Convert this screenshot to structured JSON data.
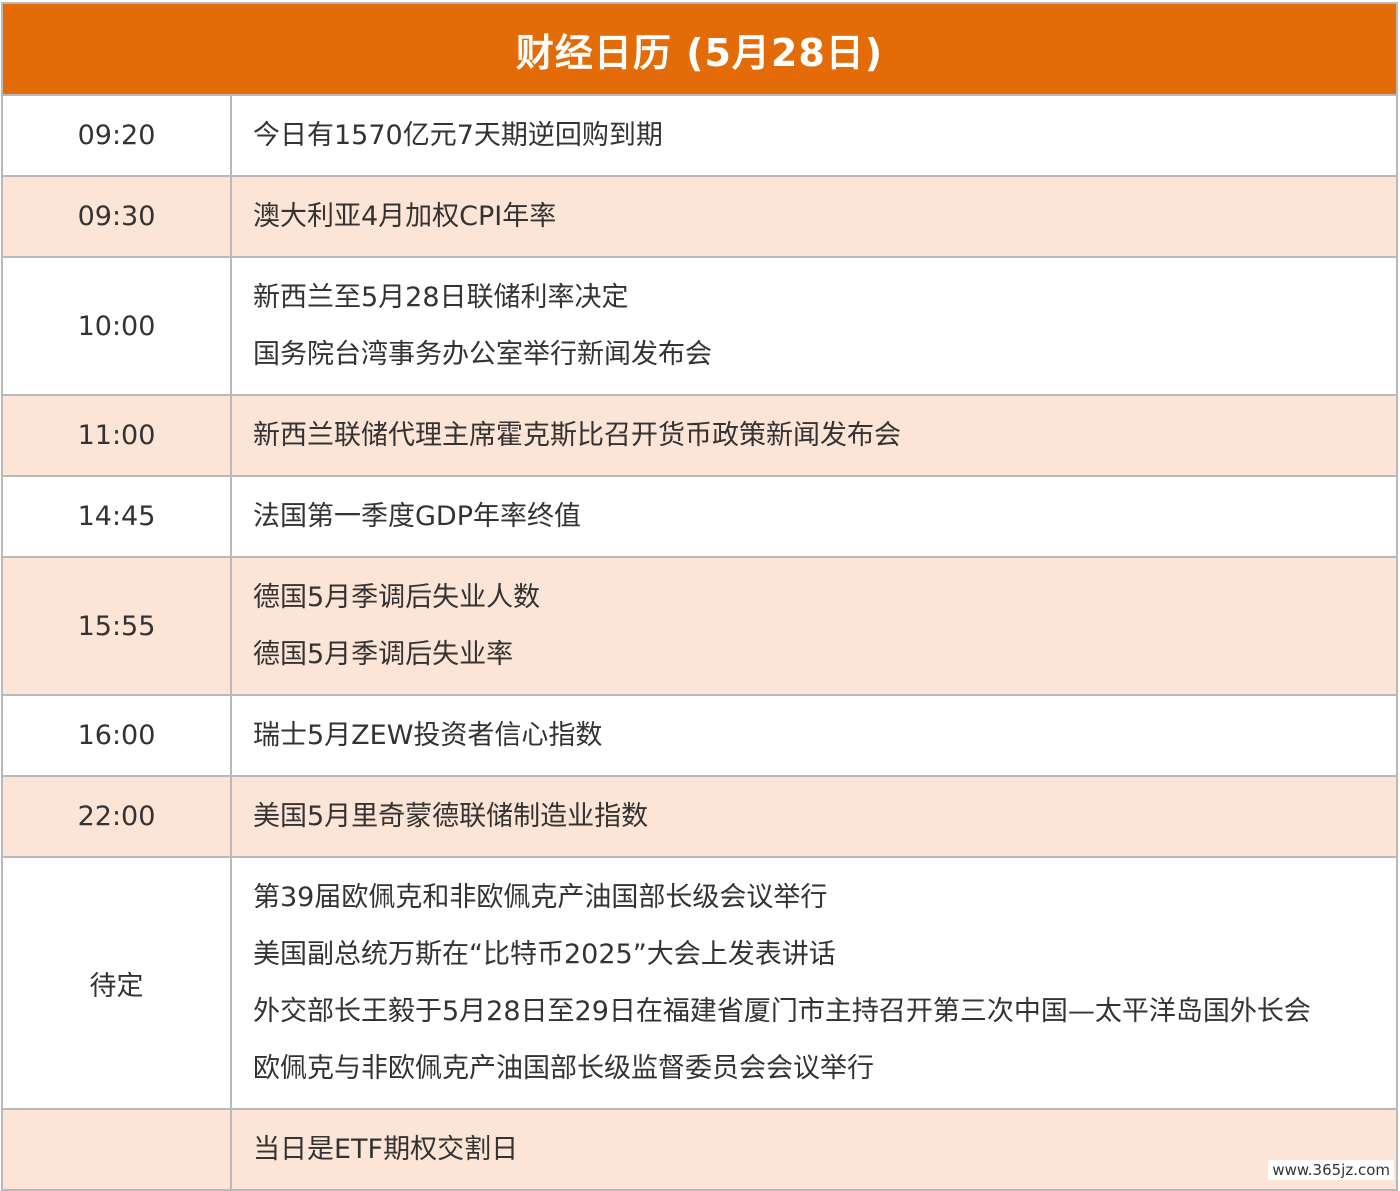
{
  "title": "财经日历 (5月28日)",
  "rows": [
    {
      "time": "09:20",
      "events": [
        "今日有1570亿元7天期逆回购到期"
      ]
    },
    {
      "time": "09:30",
      "events": [
        "澳大利亚4月加权CPI年率"
      ]
    },
    {
      "time": "10:00",
      "events": [
        "新西兰至5月28日联储利率决定",
        "国务院台湾事务办公室举行新闻发布会"
      ]
    },
    {
      "time": "11:00",
      "events": [
        "新西兰联储代理主席霍克斯比召开货币政策新闻发布会"
      ]
    },
    {
      "time": "14:45",
      "events": [
        "法国第一季度GDP年率终值"
      ]
    },
    {
      "time": "15:55",
      "events": [
        "德国5月季调后失业人数",
        "德国5月季调后失业率"
      ]
    },
    {
      "time": "16:00",
      "events": [
        "瑞士5月ZEW投资者信心指数"
      ]
    },
    {
      "time": "22:00",
      "events": [
        "美国5月里奇蒙德联储制造业指数"
      ]
    },
    {
      "time": "待定",
      "events": [
        "第39届欧佩克和非欧佩克产油国部长级会议举行",
        "美国副总统万斯在“比特币2025”大会上发表讲话",
        "外交部长王毅于5月28日至29日在福建省厦门市主持召开第三次中国—太平洋岛国外长会",
        "欧佩克与非欧佩克产油国部长级监督委员会会议举行"
      ]
    },
    {
      "time": "",
      "events": [
        "当日是ETF期权交割日"
      ]
    }
  ],
  "watermark": "www.365jz.com",
  "colors": {
    "header_bg": "#e36c09",
    "header_text": "#ffffff",
    "row_alt_bg": "#fce4d6",
    "row_bg": "#ffffff",
    "border": "#b9b9b9",
    "text": "#333333"
  }
}
